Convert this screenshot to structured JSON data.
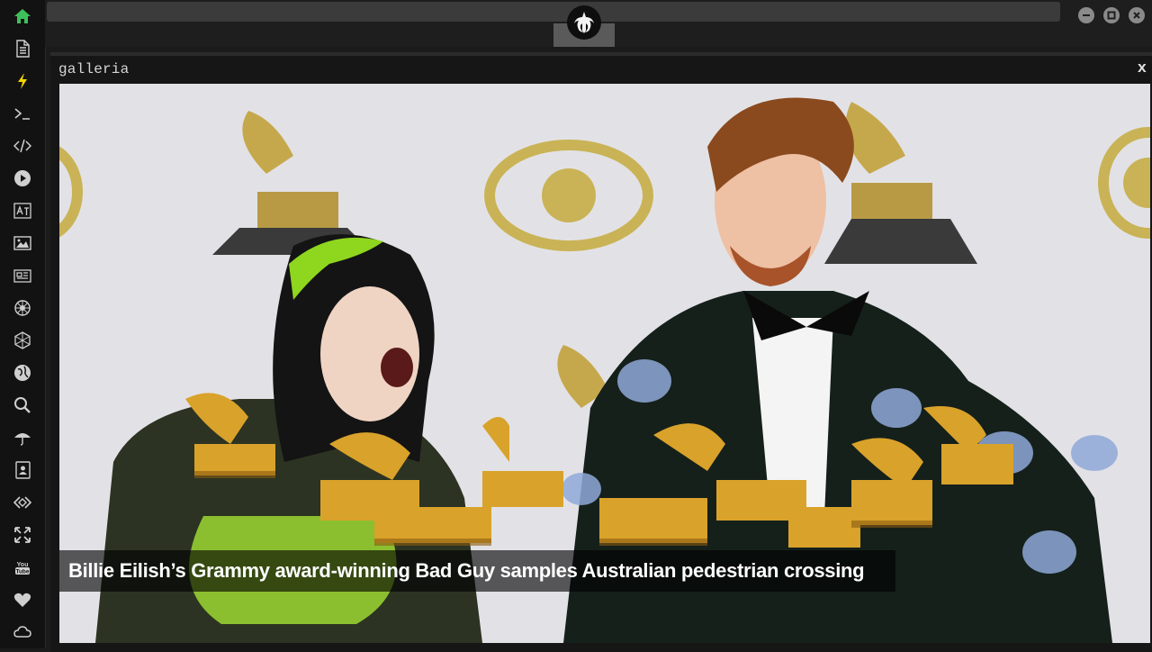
{
  "sidebar": {
    "items": [
      {
        "icon": "home-icon",
        "color": "#3fbf5a"
      },
      {
        "icon": "document-icon"
      },
      {
        "icon": "lightning-icon",
        "color": "#f2d600"
      },
      {
        "icon": "terminal-icon"
      },
      {
        "icon": "code-icon"
      },
      {
        "icon": "play-icon"
      },
      {
        "icon": "translate-icon"
      },
      {
        "icon": "image-icon"
      },
      {
        "icon": "newspaper-icon"
      },
      {
        "icon": "rebel-alliance-icon"
      },
      {
        "icon": "galactic-empire-icon"
      },
      {
        "icon": "globe-icon"
      },
      {
        "icon": "search-icon"
      },
      {
        "icon": "umbrella-icon"
      },
      {
        "icon": "contact-card-icon"
      },
      {
        "icon": "embed-icon"
      },
      {
        "icon": "expand-icon"
      },
      {
        "icon": "youtube-icon"
      },
      {
        "icon": "heart-icon"
      },
      {
        "icon": "cloud-icon"
      }
    ]
  },
  "topbar": {
    "logo_icon": "rebel-alliance-logo-icon",
    "window_buttons": [
      "minimize-icon",
      "maximize-icon",
      "close-icon"
    ]
  },
  "panel": {
    "title": "galleria",
    "close_label": "x"
  },
  "photo": {
    "caption": "Billie Eilish’s Grammy award-winning Bad Guy samples Australian pedestrian crossing"
  }
}
